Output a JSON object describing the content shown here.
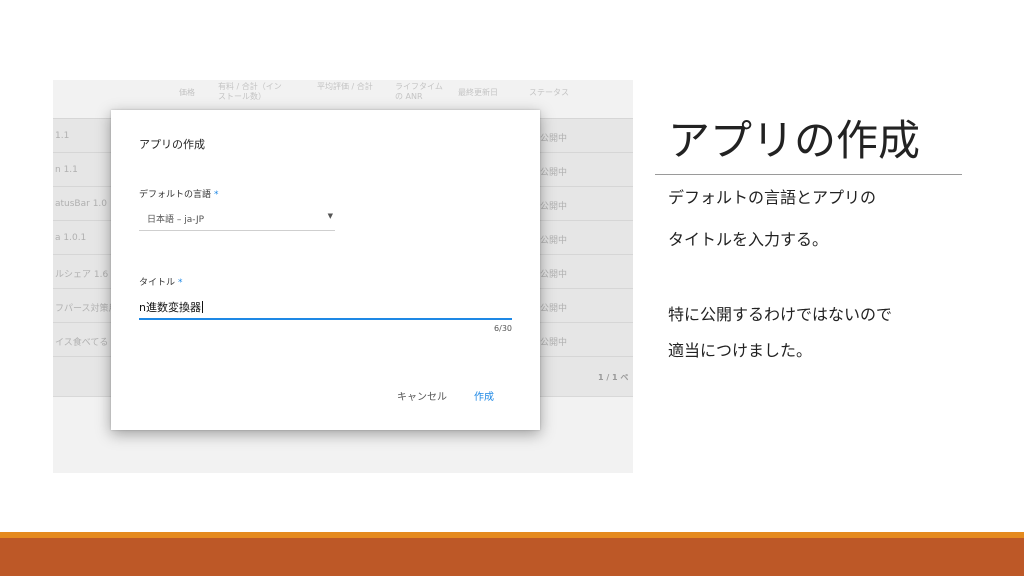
{
  "background": {
    "headers": [
      "価格",
      "有料 / 合計（インストール数）",
      "平均評価 / 合計",
      "ライフタイムの ANR",
      "最終更新日",
      "ステータス"
    ],
    "rows": [
      {
        "name": "1.1",
        "status": "公開中"
      },
      {
        "name": "n 1.1",
        "status": "公開中"
      },
      {
        "name": "atusBar 1.0",
        "status": "公開中"
      },
      {
        "name": "a 1.0.1",
        "status": "公開中"
      },
      {
        "name": "ルシェア 1.6",
        "status": "公開中"
      },
      {
        "name": "フパース対策用",
        "status": "公開中"
      },
      {
        "name": "イス食べてる 1",
        "status": "公開中"
      }
    ],
    "pager": "1 / 1 ペ"
  },
  "dialog": {
    "title": "アプリの作成",
    "language_label": "デフォルトの言語",
    "language_value": "日本語 – ja-JP",
    "title_label": "タイトル",
    "required_mark": "*",
    "title_value": "n進数変換器",
    "counter": "6/30",
    "cancel_label": "キャンセル",
    "create_label": "作成"
  },
  "slide": {
    "heading": "アプリの作成",
    "lines": [
      "デフォルトの言語とアプリの",
      "タイトルを入力する。",
      "特に公開するわけではないので",
      "適当につけました。"
    ]
  },
  "colors": {
    "accent": "#1e88e5",
    "bar_orange": "#e58a1f",
    "bar_brown": "#bd5827"
  }
}
